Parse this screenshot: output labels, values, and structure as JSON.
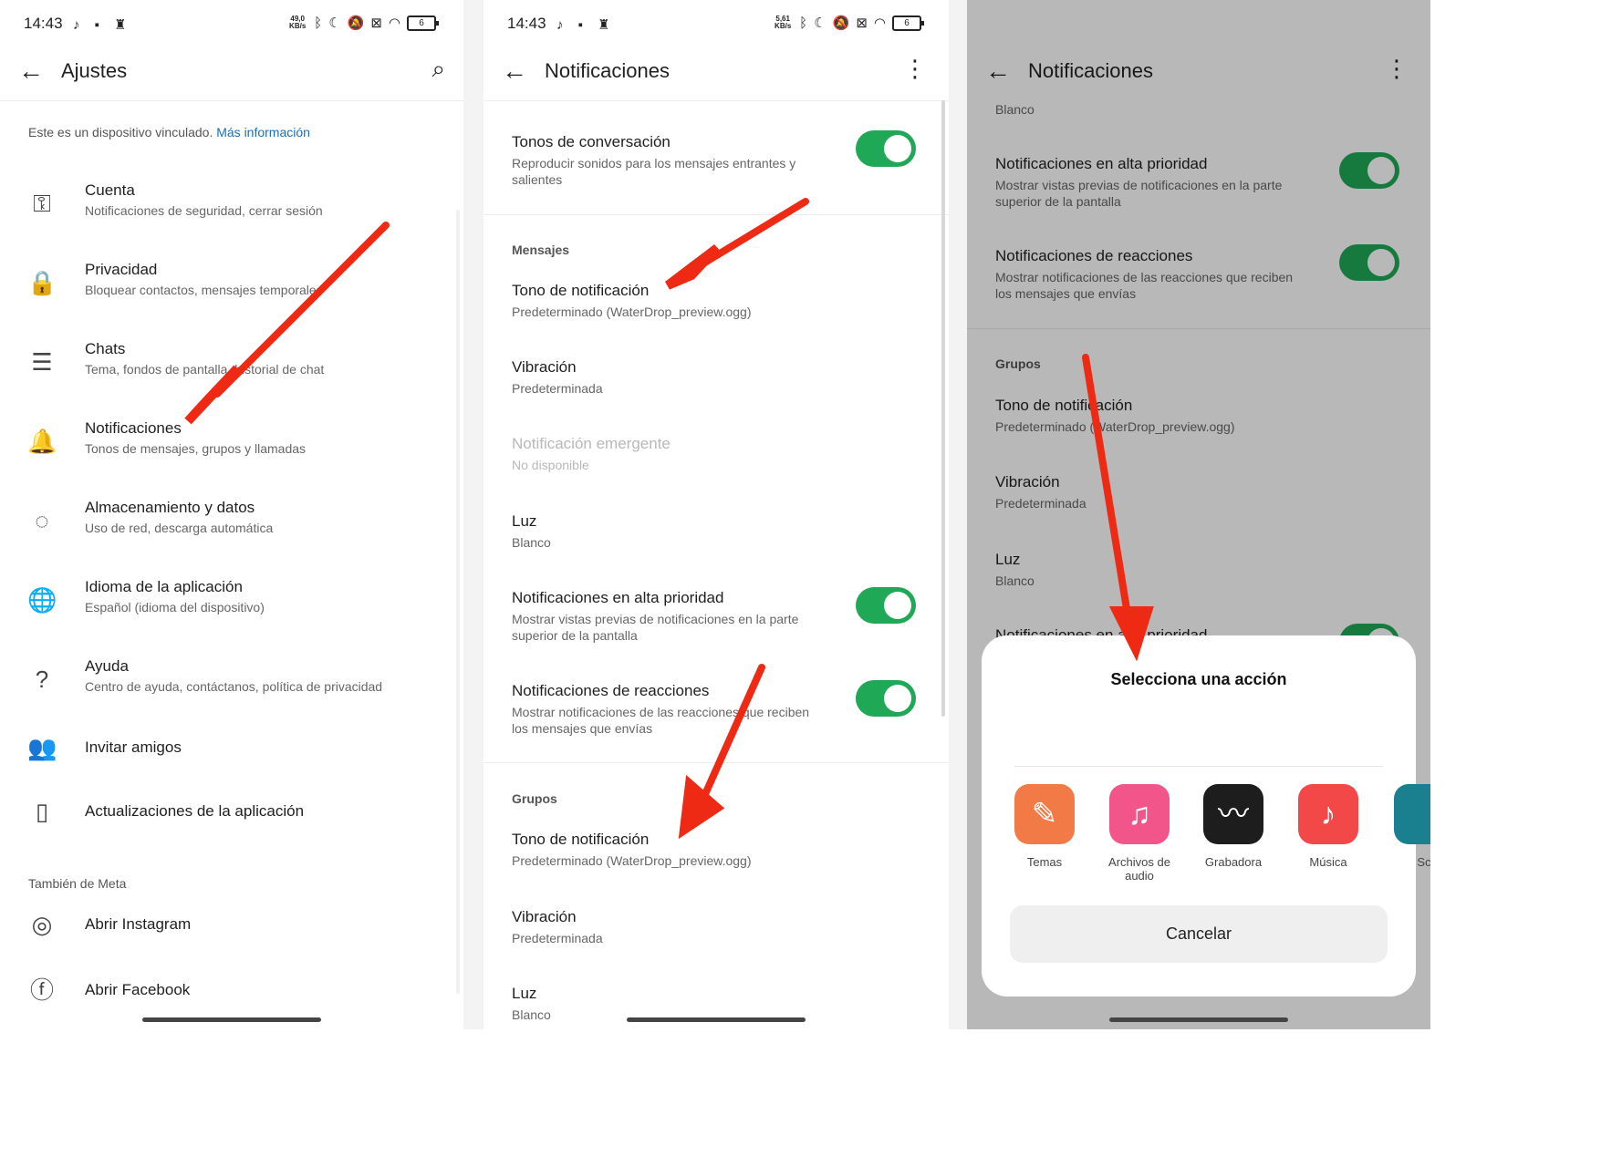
{
  "status": {
    "time": "14:43",
    "left_icons": "♪ ▪ ♜",
    "speed1": "49,0 KB/s",
    "speed2": "5,61 KB/s",
    "battery": "6"
  },
  "panel1": {
    "title": "Ajustes",
    "info_text": "Este es un dispositivo vinculado.",
    "info_link": "Más información",
    "items": [
      {
        "label": "Cuenta",
        "sub": "Notificaciones de seguridad, cerrar sesión",
        "icon": "key-icon",
        "glyph": "⚿"
      },
      {
        "label": "Privacidad",
        "sub": "Bloquear contactos, mensajes temporales",
        "icon": "lock-icon",
        "glyph": "🔒"
      },
      {
        "label": "Chats",
        "sub": "Tema, fondos de pantalla, historial de chat",
        "icon": "chat-icon",
        "glyph": "☰"
      },
      {
        "label": "Notificaciones",
        "sub": "Tonos de mensajes, grupos y llamadas",
        "icon": "bell-icon",
        "glyph": "🔔"
      },
      {
        "label": "Almacenamiento y datos",
        "sub": "Uso de red, descarga automática",
        "icon": "storage-icon",
        "glyph": "◌"
      },
      {
        "label": "Idioma de la aplicación",
        "sub": "Español (idioma del dispositivo)",
        "icon": "globe-icon",
        "glyph": "🌐"
      },
      {
        "label": "Ayuda",
        "sub": "Centro de ayuda, contáctanos, política de privacidad",
        "icon": "help-icon",
        "glyph": "?"
      },
      {
        "label": "Invitar amigos",
        "sub": "",
        "icon": "people-icon",
        "glyph": "👥"
      },
      {
        "label": "Actualizaciones de la aplicación",
        "sub": "",
        "icon": "phone-update-icon",
        "glyph": "▯"
      }
    ],
    "meta_section": "También de Meta",
    "meta_items": [
      {
        "label": "Abrir Instagram",
        "icon": "instagram-icon",
        "glyph": "◎"
      },
      {
        "label": "Abrir Facebook",
        "icon": "facebook-icon",
        "glyph": "ⓕ"
      }
    ]
  },
  "panel2": {
    "title": "Notificaciones",
    "conv": {
      "label": "Tonos de conversación",
      "sub": "Reproducir sonidos para los mensajes entrantes y salientes"
    },
    "section_messages": "Mensajes",
    "msg_rows": [
      {
        "label": "Tono de notificación",
        "sub": "Predeterminado (WaterDrop_preview.ogg)"
      },
      {
        "label": "Vibración",
        "sub": "Predeterminada"
      },
      {
        "label": "Notificación emergente",
        "sub": "No disponible"
      },
      {
        "label": "Luz",
        "sub": "Blanco"
      },
      {
        "label": "Notificaciones en alta prioridad",
        "sub": "Mostrar vistas previas de notificaciones en la parte superior de la pantalla"
      },
      {
        "label": "Notificaciones de reacciones",
        "sub": "Mostrar notificaciones de las reacciones que reciben los mensajes que envías"
      }
    ],
    "section_groups": "Grupos",
    "grp_rows": [
      {
        "label": "Tono de notificación",
        "sub": "Predeterminado (WaterDrop_preview.ogg)"
      },
      {
        "label": "Vibración",
        "sub": "Predeterminada"
      },
      {
        "label": "Luz",
        "sub": "Blanco"
      }
    ]
  },
  "panel3": {
    "title": "Notificaciones",
    "top_sub": "Blanco",
    "rows_top": [
      {
        "label": "Notificaciones en alta prioridad",
        "sub": "Mostrar vistas previas de notificaciones en la parte superior de la pantalla"
      },
      {
        "label": "Notificaciones de reacciones",
        "sub": "Mostrar notificaciones de las reacciones que reciben los mensajes que envías"
      }
    ],
    "section_groups": "Grupos",
    "grp_rows": [
      {
        "label": "Tono de notificación",
        "sub": "Predeterminado (WaterDrop_preview.ogg)"
      },
      {
        "label": "Vibración",
        "sub": "Predeterminada"
      },
      {
        "label": "Luz",
        "sub": "Blanco"
      },
      {
        "label": "Notificaciones en alta prioridad",
        "sub": ""
      }
    ],
    "sheet": {
      "title": "Selecciona una acción",
      "apps": [
        {
          "label": "Temas",
          "icon": "themes-app-icon",
          "glyph": "✎",
          "color": "#f27a46"
        },
        {
          "label": "Archivos de audio",
          "icon": "audio-files-app-icon",
          "glyph": "♫",
          "color": "#f2558a"
        },
        {
          "label": "Grabadora",
          "icon": "recorder-app-icon",
          "glyph": "〰",
          "color": "#1d1d1d"
        },
        {
          "label": "Música",
          "icon": "music-app-icon",
          "glyph": "♪",
          "color": "#f24848"
        },
        {
          "label": "Sc",
          "icon": "partial-app-icon",
          "glyph": "",
          "color": "#1a7f8e"
        }
      ],
      "cancel": "Cancelar"
    }
  },
  "colors": {
    "toggle_on": "#1fa855",
    "link": "#1b6fb8",
    "arrow": "#ee2a14"
  }
}
